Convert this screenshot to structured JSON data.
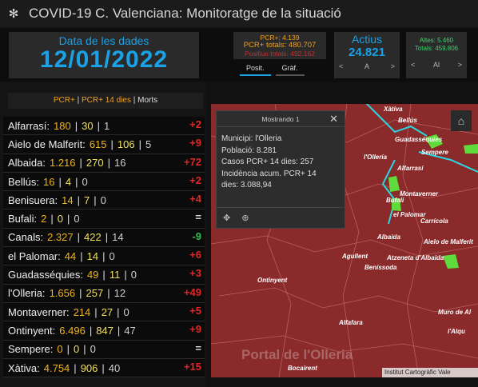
{
  "app": {
    "title": "COVID-19 C. Valenciana: Monitoratge de la situació"
  },
  "date_panel": {
    "label": "Data de les dades",
    "value": "12/01/2022"
  },
  "pcr_panel": {
    "line1": "PCR+: 4.139",
    "line2": "PCR+ totals: 480.707",
    "line3": "Positius totals: 492.162"
  },
  "tabs": [
    {
      "label": "Posit."
    },
    {
      "label": "Gràf."
    }
  ],
  "actius": {
    "label": "Actius",
    "value": "24.821",
    "prev": "<",
    "nav_label": "A",
    "next": ">"
  },
  "altes": {
    "line1": "Altes: 5.460",
    "line2": "Totals: 459.806",
    "prev": "<",
    "nav_label": "Al",
    "next": ">"
  },
  "list": {
    "header": {
      "part1": "PCR+",
      "sep1": " | ",
      "part2": "PCR+ 14 dies",
      "sep2": " | ",
      "part3": "Morts"
    },
    "rows": [
      {
        "name": "Alfarrasí:",
        "pcr": "180",
        "pcr14": "30",
        "morts": "1",
        "change": "+2",
        "dir": "up"
      },
      {
        "name": "Aielo de Malferit:",
        "pcr": "615",
        "pcr14": "106",
        "morts": "5",
        "change": "+9",
        "dir": "up"
      },
      {
        "name": "Albaida:",
        "pcr": "1.216",
        "pcr14": "270",
        "morts": "16",
        "change": "+72",
        "dir": "up"
      },
      {
        "name": "Bellús:",
        "pcr": "16",
        "pcr14": "4",
        "morts": "0",
        "change": "+2",
        "dir": "up"
      },
      {
        "name": "Benisuera:",
        "pcr": "14",
        "pcr14": "7",
        "morts": "0",
        "change": "+4",
        "dir": "up"
      },
      {
        "name": "Bufali:",
        "pcr": "2",
        "pcr14": "0",
        "morts": "0",
        "change": "=",
        "dir": "eq"
      },
      {
        "name": "Canals:",
        "pcr": "2.327",
        "pcr14": "422",
        "morts": "14",
        "change": "-9",
        "dir": "down"
      },
      {
        "name": "el Palomar:",
        "pcr": "44",
        "pcr14": "14",
        "morts": "0",
        "change": "+6",
        "dir": "up"
      },
      {
        "name": "Guadasséquies:",
        "pcr": "49",
        "pcr14": "11",
        "morts": "0",
        "change": "+3",
        "dir": "up"
      },
      {
        "name": "l'Olleria:",
        "pcr": "1.656",
        "pcr14": "257",
        "morts": "12",
        "change": "+49",
        "dir": "up"
      },
      {
        "name": "Montaverner:",
        "pcr": "214",
        "pcr14": "27",
        "morts": "0",
        "change": "+5",
        "dir": "up"
      },
      {
        "name": "Ontinyent:",
        "pcr": "6.496",
        "pcr14": "847",
        "morts": "47",
        "change": "+9",
        "dir": "up"
      },
      {
        "name": "Sempere:",
        "pcr": "0",
        "pcr14": "0",
        "morts": "0",
        "change": "=",
        "dir": "eq"
      },
      {
        "name": "Xàtiva:",
        "pcr": "4.754",
        "pcr14": "906",
        "morts": "40",
        "change": "+15",
        "dir": "up"
      }
    ]
  },
  "popup": {
    "title": "Mostrando 1",
    "close": "✕",
    "lines": [
      "Municipi: l'Olleria",
      "Població: 8.281",
      "Casos PCR+ 14 dies: 257",
      "Incidència acum. PCR+ 14",
      "dies: 3.088,94"
    ],
    "move_icon": "✥",
    "zoom_icon": "⊕"
  },
  "map": {
    "places": [
      "Xàtiva",
      "Bellús",
      "Guadasséquies",
      "Sempere",
      "l'Olleria",
      "Alfarrasí",
      "Montaverner",
      "Bufali",
      "el Palomar",
      "Carrícola",
      "Albaida",
      "Aielo de Malferit",
      "Agullent",
      "Benissoda",
      "Atzeneta d'Albaida",
      "Ontinyent",
      "Muro de Al",
      "l'Alqu",
      "Alfafara",
      "Bocairent"
    ],
    "watermark": "Portal de l'Olleria",
    "attribution": "Institut Cartogràfic Vale"
  },
  "colors": {
    "accent": "#1aa1e6",
    "map_fill": "#8a2a2a",
    "up": "#e02828",
    "down": "#2fbf4f",
    "pcr": "#f0b41e"
  }
}
